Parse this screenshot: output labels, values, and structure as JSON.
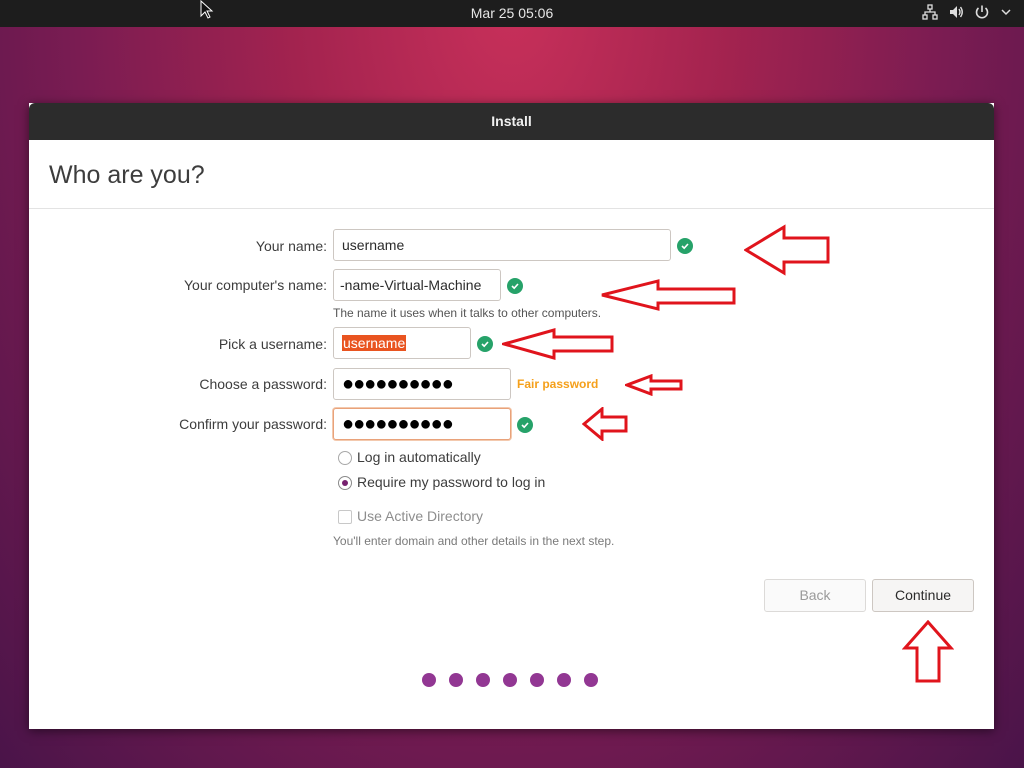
{
  "topbar": {
    "clock": "Mar 25  05:06",
    "icons": [
      "network-icon",
      "volume-icon",
      "power-icon",
      "chevron-down-icon"
    ]
  },
  "window": {
    "title": "Install",
    "heading": "Who are you?"
  },
  "form": {
    "your_name": {
      "label": "Your name:",
      "value": "username"
    },
    "computer_name": {
      "label": "Your computer's name:",
      "value": "-name-Virtual-Machine",
      "hint": "The name it uses when it talks to other computers."
    },
    "username": {
      "label": "Pick a username:",
      "value": "username"
    },
    "password": {
      "label": "Choose a password:",
      "value": "●●●●●●●●●●",
      "strength": "Fair password"
    },
    "confirm": {
      "label": "Confirm your password:",
      "value": "●●●●●●●●●●"
    },
    "login_auto": "Log in automatically",
    "login_require": "Require my password to log in",
    "active_directory": "Use Active Directory",
    "ad_hint": "You'll enter domain and other details in the next step."
  },
  "buttons": {
    "back": "Back",
    "continue": "Continue"
  },
  "progress": {
    "steps": 7,
    "current": 7
  },
  "colors": {
    "accent": "#e95420",
    "check_green": "#26a269",
    "strength_orange": "#f5a01b",
    "annotation_red": "#e0141c",
    "progress_purple": "#923793"
  }
}
